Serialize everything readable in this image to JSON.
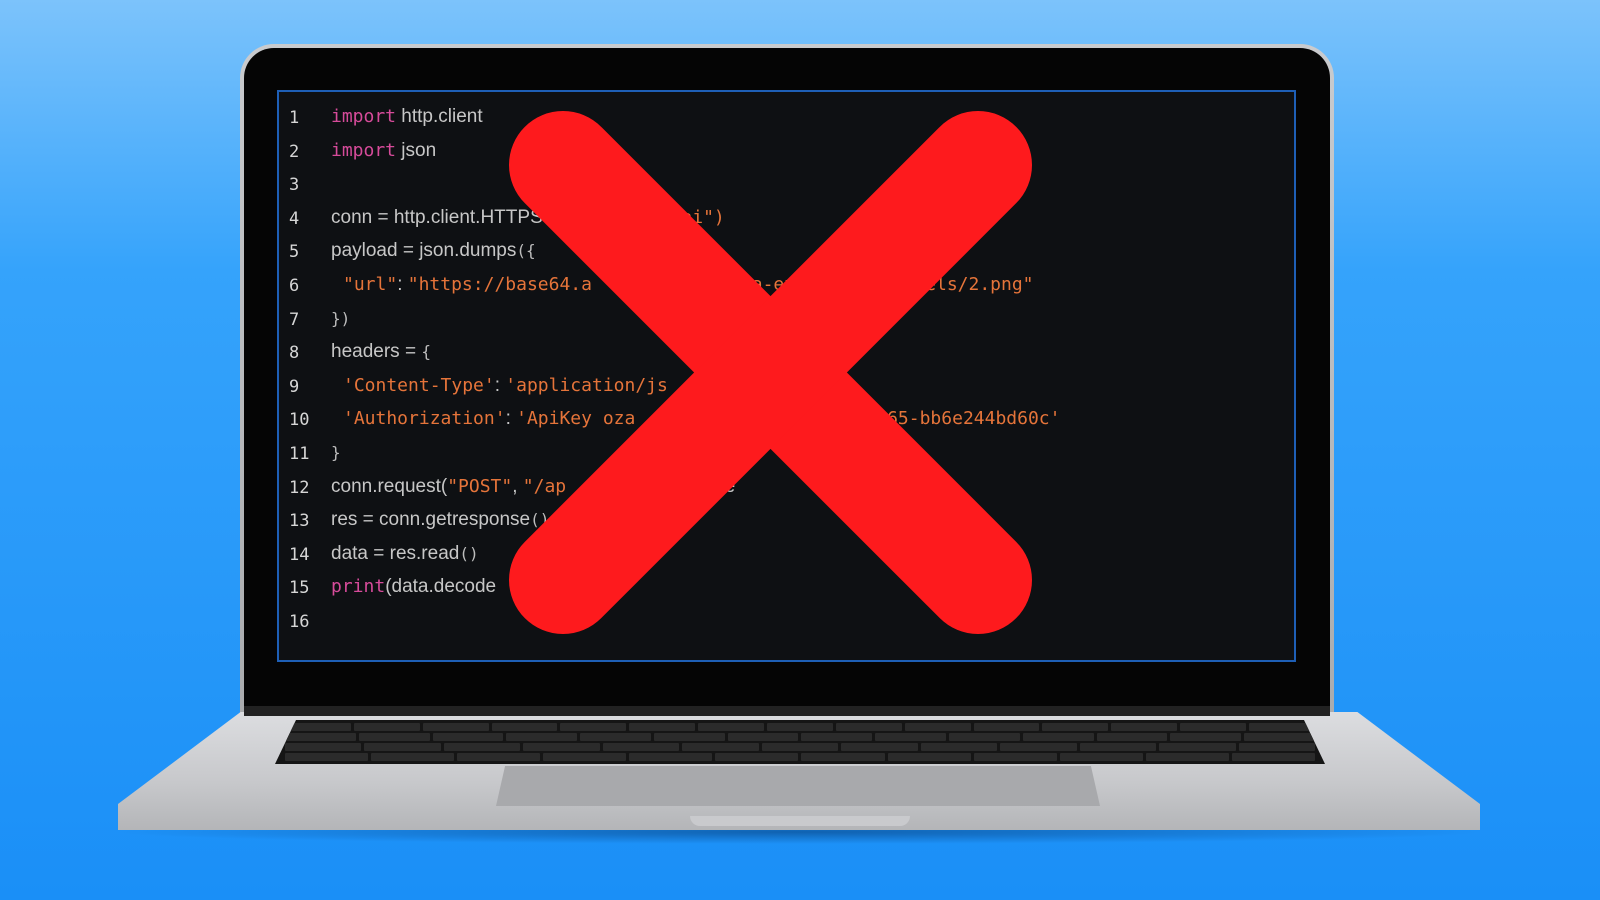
{
  "editor": {
    "lines": [
      {
        "n": "1",
        "tokens": [
          {
            "t": "import",
            "c": "kw"
          },
          {
            "t": " http.client",
            "c": "pl"
          }
        ]
      },
      {
        "n": "2",
        "tokens": [
          {
            "t": "import",
            "c": "kw"
          },
          {
            "t": " json",
            "c": "pl"
          }
        ]
      },
      {
        "n": "3",
        "tokens": []
      },
      {
        "n": "4",
        "tokens": [
          {
            "t": "conn = http.client.HTTPS",
            "c": "pl"
          },
          {
            "t": "                ",
            "c": "pl"
          },
          {
            "t": "se64.ai\")",
            "c": "str"
          }
        ]
      },
      {
        "n": "5",
        "tokens": [
          {
            "t": "payload = json.dumps",
            "c": "pl"
          },
          {
            "t": "({",
            "c": "pn"
          }
        ]
      },
      {
        "n": "6",
        "indent": true,
        "tokens": [
          {
            "t": "\"url\"",
            "c": "str"
          },
          {
            "t": ": ",
            "c": "pl"
          },
          {
            "t": "\"https://base64.a",
            "c": "str"
          },
          {
            "t": "       ",
            "c": "pl"
          },
          {
            "t": "tent",
            "c": "str"
          },
          {
            "t": "             ",
            "c": "pl"
          },
          {
            "t": "ta-extraction/models/2.png\"",
            "c": "str"
          }
        ]
      },
      {
        "n": "7",
        "tokens": [
          {
            "t": "})",
            "c": "pn"
          }
        ]
      },
      {
        "n": "8",
        "tokens": [
          {
            "t": "headers = ",
            "c": "pl"
          },
          {
            "t": "{",
            "c": "pn"
          }
        ]
      },
      {
        "n": "9",
        "indent": true,
        "tokens": [
          {
            "t": "'Content-Type'",
            "c": "str"
          },
          {
            "t": ": ",
            "c": "pl"
          },
          {
            "t": "'application/js",
            "c": "str"
          }
        ]
      },
      {
        "n": "10",
        "indent": true,
        "tokens": [
          {
            "t": "'Authorization'",
            "c": "str"
          },
          {
            "t": ": ",
            "c": "pl"
          },
          {
            "t": "'ApiKey oza",
            "c": "str"
          },
          {
            "t": "                     ",
            "c": "pl"
          },
          {
            "t": "-d03b-4537-8965-bb6e244bd60c'",
            "c": "str"
          }
        ]
      },
      {
        "n": "11",
        "tokens": [
          {
            "t": "}",
            "c": "pn"
          }
        ]
      },
      {
        "n": "12",
        "tokens": [
          {
            "t": "conn.request(",
            "c": "pl"
          },
          {
            "t": "\"POST\"",
            "c": "str"
          },
          {
            "t": ", ",
            "c": "pl"
          },
          {
            "t": "\"/ap",
            "c": "str"
          },
          {
            "t": "                ",
            "c": "pl"
          },
          {
            "t": "ad, heade",
            "c": "pl"
          }
        ]
      },
      {
        "n": "13",
        "tokens": [
          {
            "t": "res = conn.getresponse",
            "c": "pl"
          },
          {
            "t": "()",
            "c": "pn"
          }
        ]
      },
      {
        "n": "14",
        "tokens": [
          {
            "t": "data = res.read",
            "c": "pl"
          },
          {
            "t": "()",
            "c": "pn"
          }
        ]
      },
      {
        "n": "15",
        "tokens": [
          {
            "t": "print",
            "c": "kw"
          },
          {
            "t": "(data.decode",
            "c": "pl"
          }
        ]
      },
      {
        "n": "16",
        "tokens": []
      }
    ]
  },
  "overlay": {
    "icon": "red-x-icon",
    "color": "#fe1a1d"
  },
  "colors": {
    "keyword": "#d64b9a",
    "string": "#e5743a",
    "plain": "#c7c7c7",
    "background": "#0e1013",
    "frame": "#1e5fb6"
  }
}
